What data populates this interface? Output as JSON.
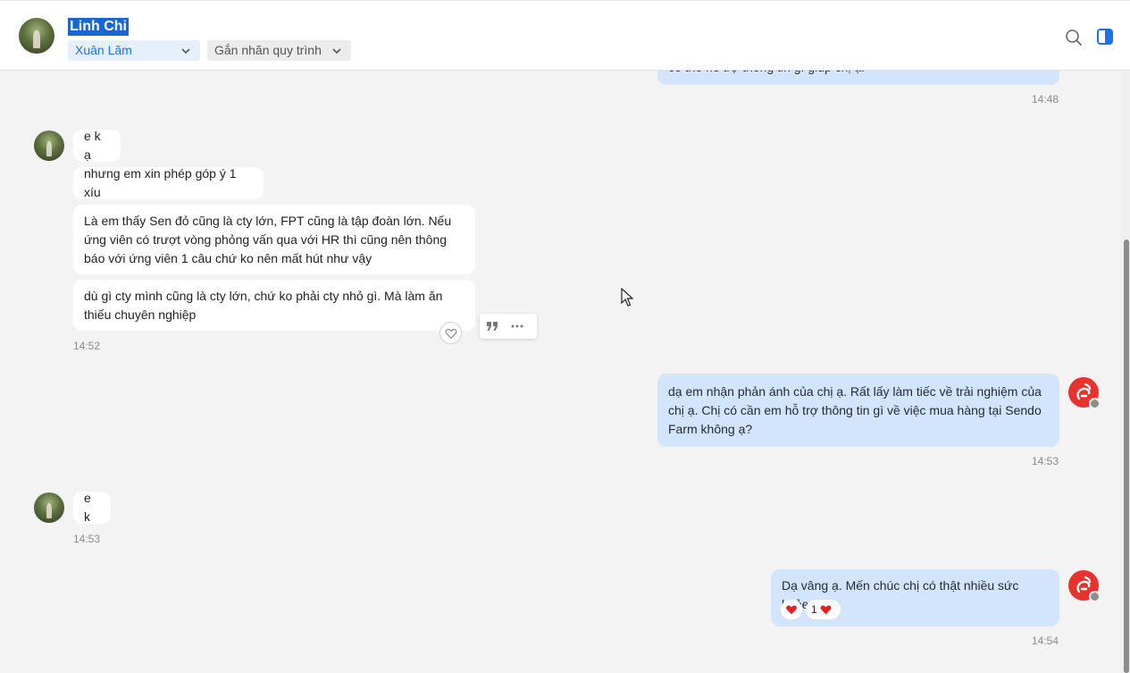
{
  "header": {
    "contact_name": "Linh Chi",
    "assignee": "Xuân Lãm",
    "tag_label": "Gắn nhãn quy trình",
    "icons": [
      "search-icon",
      "side-panel-icon"
    ]
  },
  "colors": {
    "outgoing_bubble": "#d3e4fd",
    "incoming_bubble": "#ffffff",
    "accent": "#1a73e8",
    "brand": "#e8322f",
    "background": "#f3f3f3"
  },
  "messages": {
    "m0": {
      "text": "có thể hỗ trợ thông tin gì giúp chị ạ.",
      "time": "14:48"
    },
    "g1": {
      "b1": "e k ạ",
      "b2": "nhưng em xin phép góp ý 1 xíu",
      "b3": "Là em thấy Sen đỏ cũng là cty lớn, FPT cũng là tập đoàn lớn. Nếu ứng viên có trượt vòng phỏng vấn qua với HR thì cũng nên thông báo với ứng viên 1 câu chứ ko nên mất hút như vậy",
      "b4": "dù gì cty mình cũng là cty lớn, chứ ko phải cty nhỏ gì. Mà làm ăn thiếu chuyên nghiệp",
      "time": "14:52"
    },
    "m2": {
      "text": "dạ em nhận phản ánh của chị ạ. Rất lấy làm tiếc về trải nghiệm của chị ạ. Chị có cần em hỗ trợ thông tin gì về việc mua hàng tại Sendo Farm không ạ?",
      "time": "14:53"
    },
    "m3": {
      "text": "e k",
      "time": "14:53"
    },
    "m4": {
      "text": "Dạ vâng ạ. Mến chúc chị có thật nhiều sức khỏe.",
      "time": "14:54",
      "reaction_count": "1"
    }
  }
}
